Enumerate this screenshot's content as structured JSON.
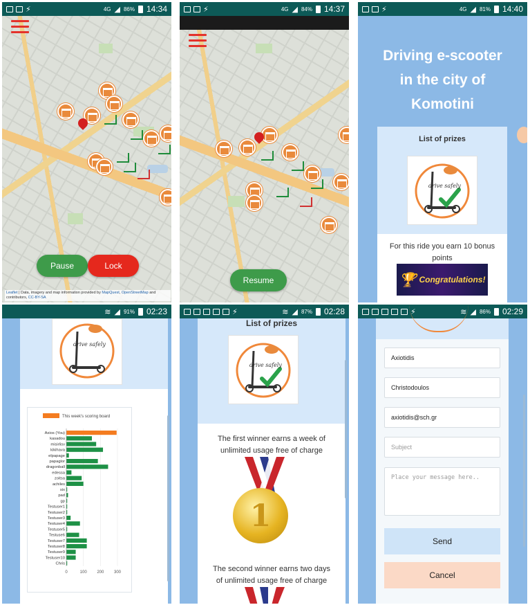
{
  "panels": {
    "p1": {
      "status": {
        "battery": "86%",
        "time": "14:34",
        "net": "4G"
      },
      "pause_label": "Pause",
      "lock_label": "Lock",
      "attribution_a": "Leaflet",
      "attribution_b": " | Data, imagery and map information provided by ",
      "attribution_c": "MapQuest",
      "attribution_d": ", ",
      "attribution_e": "OpenStreetMap",
      "attribution_f": " and contributors, ",
      "attribution_g": "CC-BY-SA"
    },
    "p2": {
      "status": {
        "battery": "84%",
        "time": "14:37",
        "net": "4G"
      },
      "resume_label": "Resume"
    },
    "p3": {
      "status": {
        "battery": "81%",
        "time": "14:40",
        "net": "4G"
      },
      "title_line1": "Driving e-scooter",
      "title_line2": "in the city of",
      "title_line3": "Komotini",
      "prizes_heading": "List of prizes",
      "logo_text": "drive safely",
      "bonus_line1": "For this ride you earn 10 bonus",
      "bonus_line2": "points",
      "congrats_text": "Congratulations!"
    },
    "p4": {
      "status": {
        "battery": "91%",
        "time": "02:23"
      },
      "logo_text": "drive safely"
    },
    "p5": {
      "status": {
        "battery": "87%",
        "time": "02:28"
      },
      "prizes_heading": "List of prizes",
      "logo_text": "drive safely",
      "first_line1": "The first winner earns a week of",
      "first_line2": "unlimited usage free of charge",
      "medal_number": "1",
      "second_line1": "The second winner earns two days",
      "second_line2": "of unlimited usage free of charge"
    },
    "p6": {
      "status": {
        "battery": "86%",
        "time": "02:29"
      },
      "last_name": "Axiotidis",
      "first_name": "Christodoulos",
      "email": "axiotidis@sch.gr",
      "subject_placeholder": "Subject",
      "message_placeholder": "Place your message here..",
      "send_label": "Send",
      "cancel_label": "Cancel"
    }
  },
  "colors": {
    "status_bar": "#0d5a57",
    "app_blue": "#8cb9e6",
    "card_head": "#d6e8fa",
    "station_orange": "#e98a3c",
    "button_green": "#3e9b4a",
    "button_red": "#e5281d",
    "send_bg": "#cfe4f8",
    "cancel_bg": "#fbd9c6",
    "bar_green": "#1e9146",
    "bar_orange": "#f47c20"
  },
  "chart_data": {
    "type": "bar",
    "orientation": "horizontal",
    "title": "",
    "legend": [
      "This week's scoring board"
    ],
    "categories": [
      "Axios (You)",
      "kasadou",
      "misirlisv",
      "kikihava",
      "elpapage",
      "papaglor",
      "dragonball",
      "edessa",
      "zoitsa",
      "achiles",
      "six",
      "pad",
      "gp",
      "Testuser1",
      "Testuser2",
      "Testuser3",
      "Testuser4",
      "Testuser5",
      "Testuse6",
      "Testuser7",
      "Testuser8",
      "Testuser9",
      "Testuser10",
      "Chris"
    ],
    "series": [
      {
        "name": "This week's scoring board",
        "values": [
          295,
          150,
          175,
          215,
          15,
          185,
          245,
          30,
          90,
          100,
          5,
          10,
          5,
          5,
          5,
          25,
          80,
          5,
          75,
          120,
          120,
          55,
          55,
          5
        ]
      }
    ],
    "xlim": [
      0,
      300
    ],
    "xticks": [
      0,
      100,
      200,
      300
    ],
    "highlight_index": 0
  }
}
